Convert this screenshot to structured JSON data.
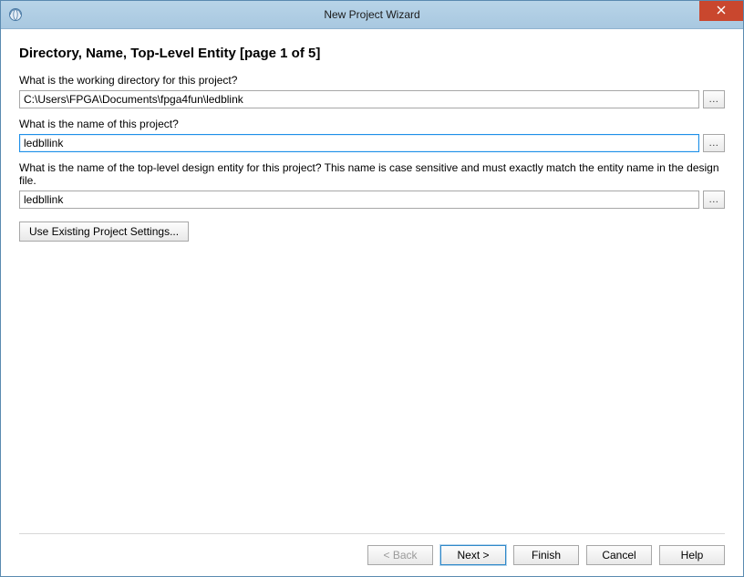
{
  "window": {
    "title": "New Project Wizard"
  },
  "page": {
    "heading": "Directory, Name, Top-Level Entity [page 1 of 5]"
  },
  "fields": {
    "directory": {
      "label": "What is the working directory for this project?",
      "value": "C:\\Users\\FPGA\\Documents\\fpga4fun\\ledblink",
      "browse_label": "..."
    },
    "project_name": {
      "label": "What is the name of this project?",
      "value": "ledbllink",
      "browse_label": "..."
    },
    "top_entity": {
      "label": "What is the name of the top-level design entity for this project? This name is case sensitive and must exactly match the entity name in the design file.",
      "value": "ledbllink",
      "browse_label": "..."
    }
  },
  "buttons": {
    "use_existing": "Use Existing Project Settings...",
    "back": "< Back",
    "next": "Next >",
    "finish": "Finish",
    "cancel": "Cancel",
    "help": "Help"
  }
}
